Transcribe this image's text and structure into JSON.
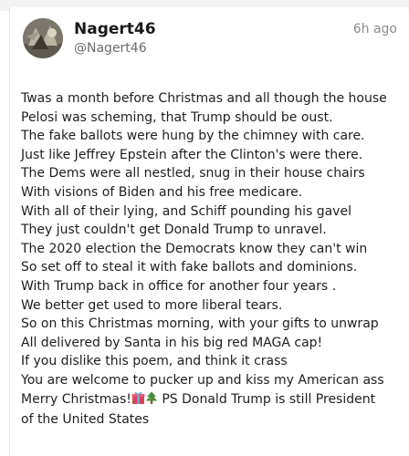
{
  "post": {
    "author": {
      "display_name": "Nagert46",
      "handle": "@Nagert46"
    },
    "time_ago": "6h ago",
    "lines": [
      "Twas a month before Christmas and all though the house",
      "Pelosi was scheming, that Trump should be oust.",
      "The fake ballots were hung by the chimney with care.",
      "Just like Jeffrey Epstein after the Clinton's were there.",
      "The Dems were all nestled, snug in their house chairs",
      "With visions of Biden and his free medicare.",
      "With all of their lying, and Schiff pounding his gavel",
      "They just couldn't get Donald Trump to unravel.",
      "The 2020 election the Democrats know they can't win",
      "So set off to steal it with fake ballots and dominions.",
      "With Trump back in office for another four years .",
      "We better get used to more liberal tears.",
      "So on this Christmas morning, with your gifts to unwrap",
      "All delivered by Santa in his big red MAGA cap!",
      "If you dislike this poem, and think it crass",
      "You are welcome to pucker up and kiss my American ass"
    ],
    "closing": {
      "before_emoji": "Merry Christmas!",
      "emoji_icons": [
        "gift-icon",
        "christmas-tree-icon"
      ],
      "after_emoji": " PS Donald Trump is still President",
      "last_line": "of the United States"
    }
  },
  "colors": {
    "name": "#1a1a1a",
    "handle": "#6b6b6b",
    "time": "#8a8a8a",
    "body_text": "#1e1e1e"
  }
}
